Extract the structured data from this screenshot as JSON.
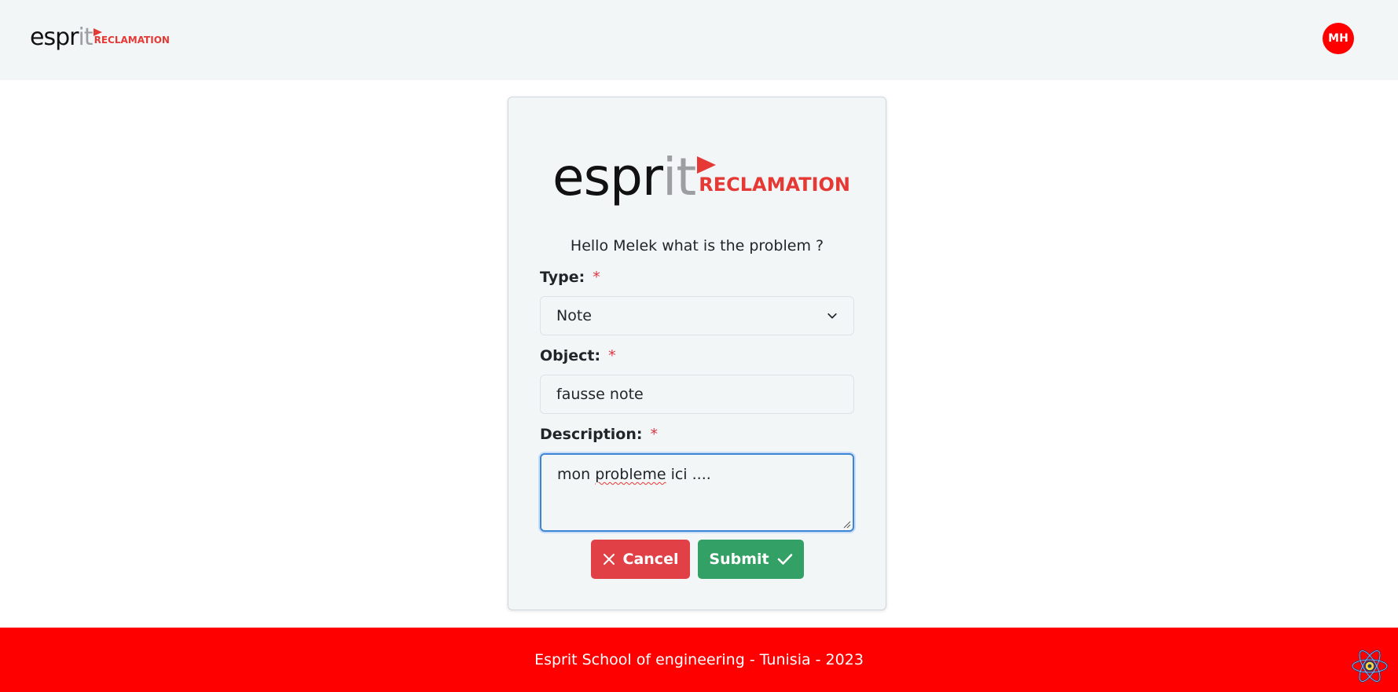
{
  "header": {
    "logo": {
      "part1": "espr",
      "part2": "it",
      "part3": "RECLAMATION"
    },
    "avatar_initials": "MH"
  },
  "card": {
    "logo": {
      "part1": "espr",
      "part2": "it",
      "part3": "RECLAMATION"
    },
    "greeting": "Hello Melek what is the problem ?",
    "type": {
      "label": "Type:",
      "required": "*",
      "value": "Note"
    },
    "object": {
      "label": "Object:",
      "required": "*",
      "value": "fausse note"
    },
    "description": {
      "label": "Description:",
      "required": "*",
      "value_prefix": "mon ",
      "value_misspelled": "probleme",
      "value_suffix": " ici ...."
    },
    "cancel_label": "Cancel",
    "submit_label": "Submit"
  },
  "footer": {
    "text": "Esprit School of engineering - Tunisia - 2023"
  },
  "colors": {
    "brand_red": "#e53935",
    "footer_red": "#ff0000",
    "cancel": "#e04046",
    "submit": "#33a066",
    "focus": "#3d86d6"
  },
  "icons": [
    "chevron-down-icon",
    "close-icon",
    "check-icon",
    "react-icon"
  ]
}
